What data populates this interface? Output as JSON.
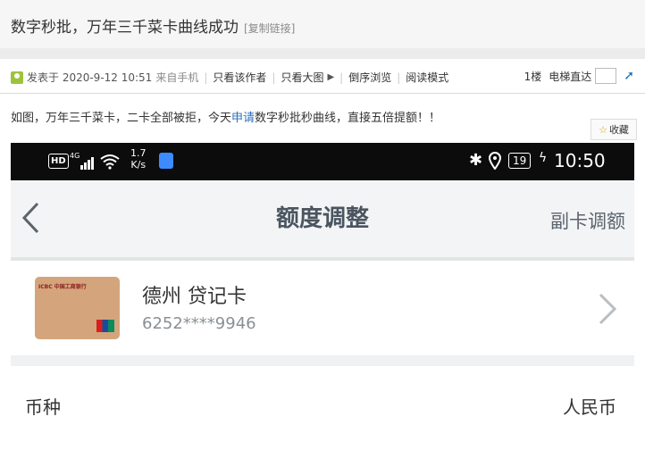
{
  "post": {
    "title": "数字秒批，万年三千菜卡曲线成功",
    "copy_link": "[复制链接]",
    "meta": {
      "posted_at": "发表于 2020-9-12 10:51",
      "source": "来自手机",
      "author_only": "只看该作者",
      "big_image": "只看大图",
      "reverse": "倒序浏览",
      "reading_mode": "阅读模式",
      "floor": "1楼",
      "elevator": "电梯直达"
    },
    "body_pre": "如图，万年三千菜卡，二卡全部被拒，今天",
    "body_link": "申请",
    "body_post": "数字秒批秒曲线，直接五倍提额！！",
    "favorite": "收藏"
  },
  "phone": {
    "status": {
      "hd": "HD",
      "net": "4G",
      "speed_value": "1.7",
      "speed_unit": "K/s",
      "battery": "19",
      "time": "10:50"
    },
    "nav": {
      "title": "额度调整",
      "right_action": "副卡调额"
    },
    "card": {
      "bank_text": "ICBC 中国工商银行",
      "name": "德州 贷记卡",
      "number": "6252****9946"
    },
    "currency": {
      "label": "币种",
      "value": "人民币"
    }
  }
}
